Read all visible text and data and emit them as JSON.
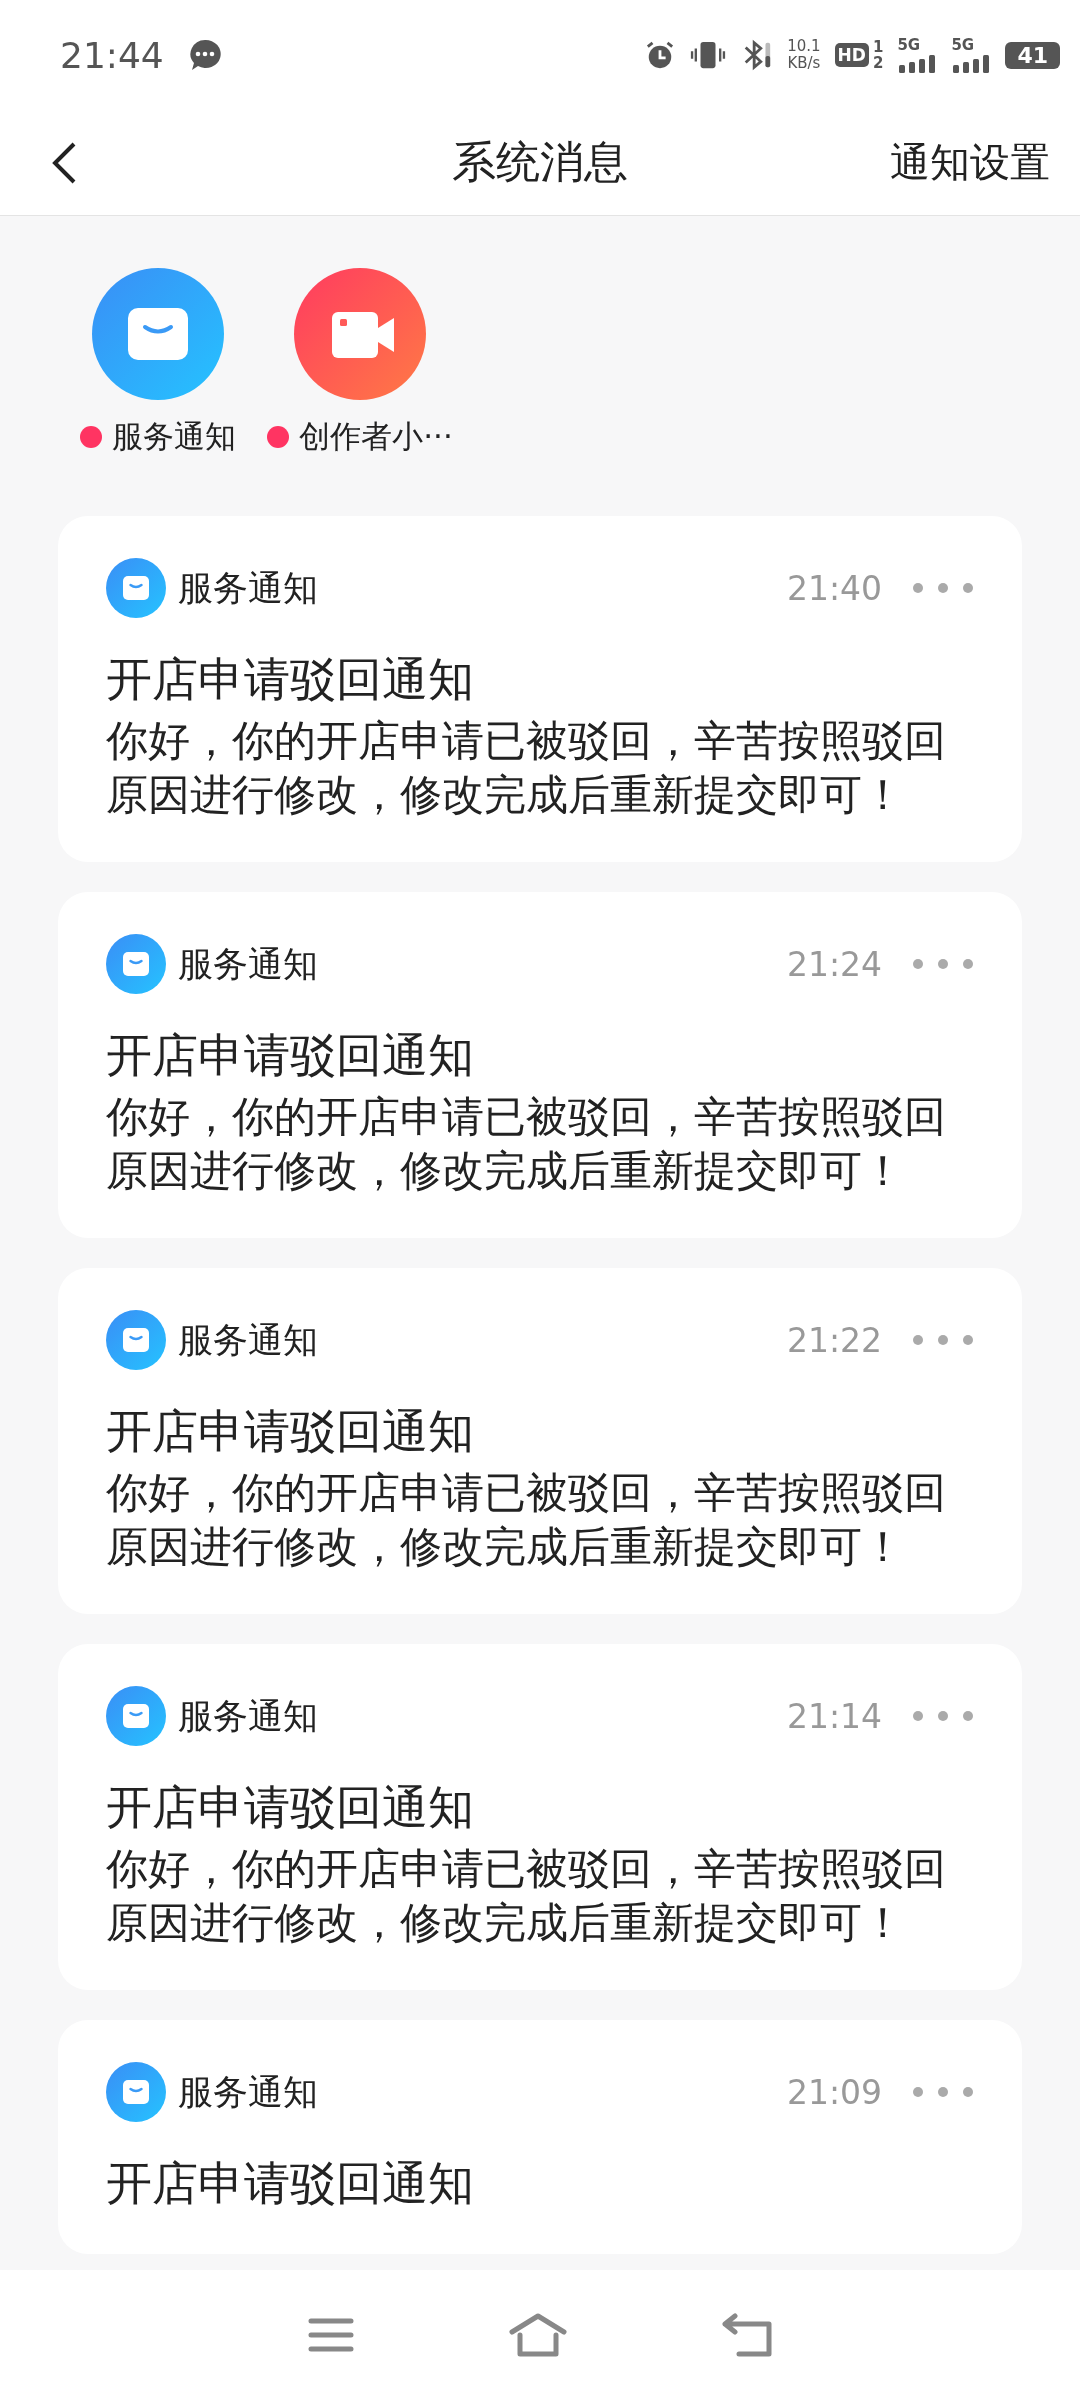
{
  "status_bar": {
    "time": "21:44",
    "net_speed": "10.1",
    "net_unit": "KB/s",
    "hd": "HD",
    "sim_1": "1",
    "sim_2": "2",
    "network_1": "5G",
    "network_2": "5G",
    "battery": "41"
  },
  "header": {
    "title": "系统消息",
    "action": "通知设置"
  },
  "shortcuts": [
    {
      "kind": "service",
      "label": "服务通知",
      "unread": true
    },
    {
      "kind": "creator",
      "label": "创作者小···",
      "unread": true
    }
  ],
  "messages": [
    {
      "source": "服务通知",
      "time": "21:40",
      "title": "开店申请驳回通知",
      "body": "你好，你的开店申请已被驳回，辛苦按照驳回原因进行修改，修改完成后重新提交即可！"
    },
    {
      "source": "服务通知",
      "time": "21:24",
      "title": "开店申请驳回通知",
      "body": "你好，你的开店申请已被驳回，辛苦按照驳回原因进行修改，修改完成后重新提交即可！"
    },
    {
      "source": "服务通知",
      "time": "21:22",
      "title": "开店申请驳回通知",
      "body": "你好，你的开店申请已被驳回，辛苦按照驳回原因进行修改，修改完成后重新提交即可！"
    },
    {
      "source": "服务通知",
      "time": "21:14",
      "title": "开店申请驳回通知",
      "body": "你好，你的开店申请已被驳回，辛苦按照驳回原因进行修改，修改完成后重新提交即可！"
    },
    {
      "source": "服务通知",
      "time": "21:09",
      "title": "开店申请驳回通知"
    }
  ]
}
